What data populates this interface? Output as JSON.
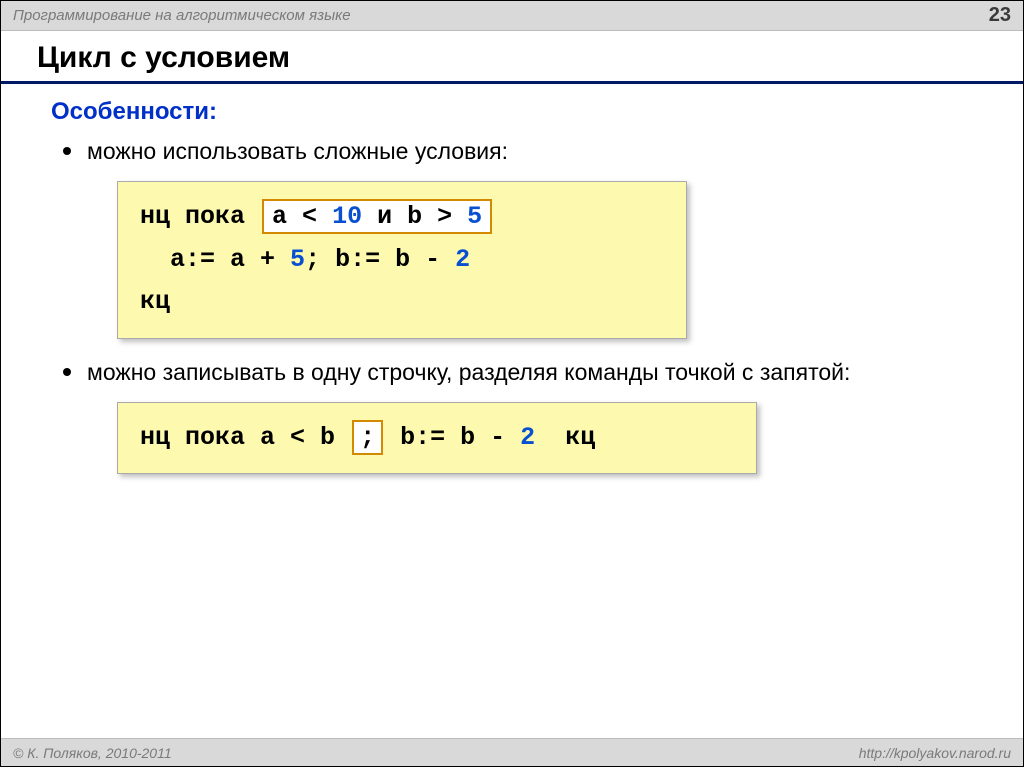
{
  "header": {
    "title": "Программирование на алгоритмическом языке",
    "page": "23"
  },
  "title": "Цикл с условием",
  "subhead": "Особенности:",
  "bullets": [
    "можно использовать сложные условия:",
    "можно записывать в одну строчку, разделяя команды точкой с запятой:"
  ],
  "code1": {
    "kw_start": "нц пока",
    "cond_a": "a <",
    "cond_10": "10",
    "cond_and": "и b >",
    "cond_5": "5",
    "line2a": "  a:= a +",
    "line2n1": "5",
    "line2b": "; b:= b -",
    "line2n2": "2",
    "kw_end": "кц"
  },
  "code2": {
    "kw_start": "нц пока",
    "cond": "a < b",
    "semi": ";",
    "body_a": "b:= b -",
    "body_n": "2",
    "kw_end": "кц"
  },
  "footer": {
    "copyright": "© К. Поляков, 2010-2011",
    "url": "http://kpolyakov.narod.ru"
  }
}
